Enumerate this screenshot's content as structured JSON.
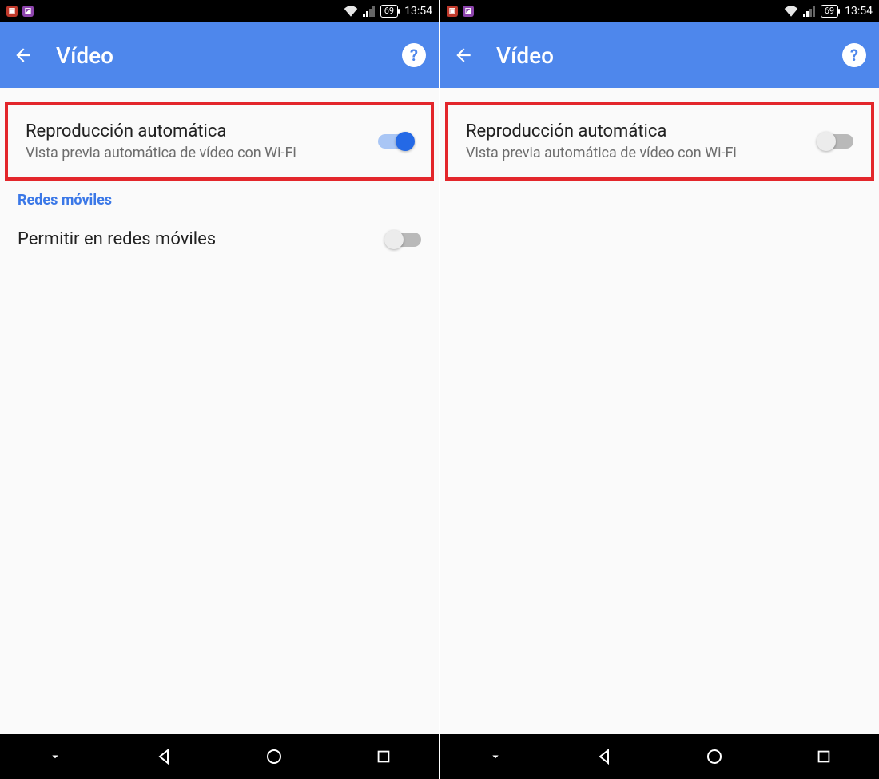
{
  "status": {
    "battery": "69",
    "time": "13:54"
  },
  "header": {
    "title": "Vídeo"
  },
  "left": {
    "autoplay": {
      "title": "Reproducción automática",
      "subtitle": "Vista previa automática de vídeo con Wi-Fi",
      "enabled": true
    },
    "section": "Redes móviles",
    "mobile": {
      "title": "Permitir en redes móviles",
      "enabled": false
    }
  },
  "right": {
    "autoplay": {
      "title": "Reproducción automática",
      "subtitle": "Vista previa automática de vídeo con Wi-Fi",
      "enabled": false
    }
  }
}
